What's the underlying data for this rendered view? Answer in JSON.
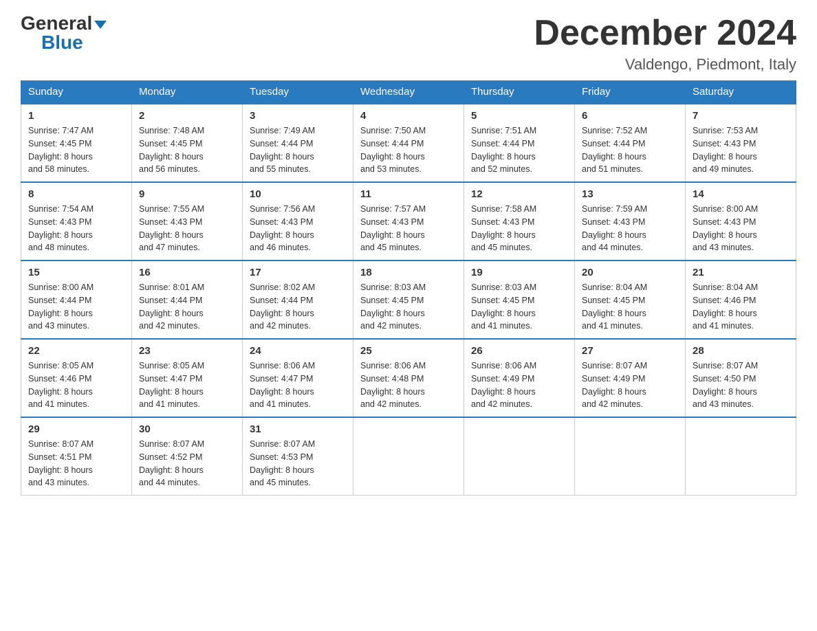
{
  "header": {
    "logo_general": "General",
    "logo_blue": "Blue",
    "month_title": "December 2024",
    "location": "Valdengo, Piedmont, Italy"
  },
  "days_of_week": [
    "Sunday",
    "Monday",
    "Tuesday",
    "Wednesday",
    "Thursday",
    "Friday",
    "Saturday"
  ],
  "weeks": [
    [
      {
        "day": 1,
        "sunrise": "7:47 AM",
        "sunset": "4:45 PM",
        "daylight": "8 hours and 58 minutes."
      },
      {
        "day": 2,
        "sunrise": "7:48 AM",
        "sunset": "4:45 PM",
        "daylight": "8 hours and 56 minutes."
      },
      {
        "day": 3,
        "sunrise": "7:49 AM",
        "sunset": "4:44 PM",
        "daylight": "8 hours and 55 minutes."
      },
      {
        "day": 4,
        "sunrise": "7:50 AM",
        "sunset": "4:44 PM",
        "daylight": "8 hours and 53 minutes."
      },
      {
        "day": 5,
        "sunrise": "7:51 AM",
        "sunset": "4:44 PM",
        "daylight": "8 hours and 52 minutes."
      },
      {
        "day": 6,
        "sunrise": "7:52 AM",
        "sunset": "4:44 PM",
        "daylight": "8 hours and 51 minutes."
      },
      {
        "day": 7,
        "sunrise": "7:53 AM",
        "sunset": "4:43 PM",
        "daylight": "8 hours and 49 minutes."
      }
    ],
    [
      {
        "day": 8,
        "sunrise": "7:54 AM",
        "sunset": "4:43 PM",
        "daylight": "8 hours and 48 minutes."
      },
      {
        "day": 9,
        "sunrise": "7:55 AM",
        "sunset": "4:43 PM",
        "daylight": "8 hours and 47 minutes."
      },
      {
        "day": 10,
        "sunrise": "7:56 AM",
        "sunset": "4:43 PM",
        "daylight": "8 hours and 46 minutes."
      },
      {
        "day": 11,
        "sunrise": "7:57 AM",
        "sunset": "4:43 PM",
        "daylight": "8 hours and 45 minutes."
      },
      {
        "day": 12,
        "sunrise": "7:58 AM",
        "sunset": "4:43 PM",
        "daylight": "8 hours and 45 minutes."
      },
      {
        "day": 13,
        "sunrise": "7:59 AM",
        "sunset": "4:43 PM",
        "daylight": "8 hours and 44 minutes."
      },
      {
        "day": 14,
        "sunrise": "8:00 AM",
        "sunset": "4:43 PM",
        "daylight": "8 hours and 43 minutes."
      }
    ],
    [
      {
        "day": 15,
        "sunrise": "8:00 AM",
        "sunset": "4:44 PM",
        "daylight": "8 hours and 43 minutes."
      },
      {
        "day": 16,
        "sunrise": "8:01 AM",
        "sunset": "4:44 PM",
        "daylight": "8 hours and 42 minutes."
      },
      {
        "day": 17,
        "sunrise": "8:02 AM",
        "sunset": "4:44 PM",
        "daylight": "8 hours and 42 minutes."
      },
      {
        "day": 18,
        "sunrise": "8:03 AM",
        "sunset": "4:45 PM",
        "daylight": "8 hours and 42 minutes."
      },
      {
        "day": 19,
        "sunrise": "8:03 AM",
        "sunset": "4:45 PM",
        "daylight": "8 hours and 41 minutes."
      },
      {
        "day": 20,
        "sunrise": "8:04 AM",
        "sunset": "4:45 PM",
        "daylight": "8 hours and 41 minutes."
      },
      {
        "day": 21,
        "sunrise": "8:04 AM",
        "sunset": "4:46 PM",
        "daylight": "8 hours and 41 minutes."
      }
    ],
    [
      {
        "day": 22,
        "sunrise": "8:05 AM",
        "sunset": "4:46 PM",
        "daylight": "8 hours and 41 minutes."
      },
      {
        "day": 23,
        "sunrise": "8:05 AM",
        "sunset": "4:47 PM",
        "daylight": "8 hours and 41 minutes."
      },
      {
        "day": 24,
        "sunrise": "8:06 AM",
        "sunset": "4:47 PM",
        "daylight": "8 hours and 41 minutes."
      },
      {
        "day": 25,
        "sunrise": "8:06 AM",
        "sunset": "4:48 PM",
        "daylight": "8 hours and 42 minutes."
      },
      {
        "day": 26,
        "sunrise": "8:06 AM",
        "sunset": "4:49 PM",
        "daylight": "8 hours and 42 minutes."
      },
      {
        "day": 27,
        "sunrise": "8:07 AM",
        "sunset": "4:49 PM",
        "daylight": "8 hours and 42 minutes."
      },
      {
        "day": 28,
        "sunrise": "8:07 AM",
        "sunset": "4:50 PM",
        "daylight": "8 hours and 43 minutes."
      }
    ],
    [
      {
        "day": 29,
        "sunrise": "8:07 AM",
        "sunset": "4:51 PM",
        "daylight": "8 hours and 43 minutes."
      },
      {
        "day": 30,
        "sunrise": "8:07 AM",
        "sunset": "4:52 PM",
        "daylight": "8 hours and 44 minutes."
      },
      {
        "day": 31,
        "sunrise": "8:07 AM",
        "sunset": "4:53 PM",
        "daylight": "8 hours and 45 minutes."
      },
      null,
      null,
      null,
      null
    ]
  ]
}
